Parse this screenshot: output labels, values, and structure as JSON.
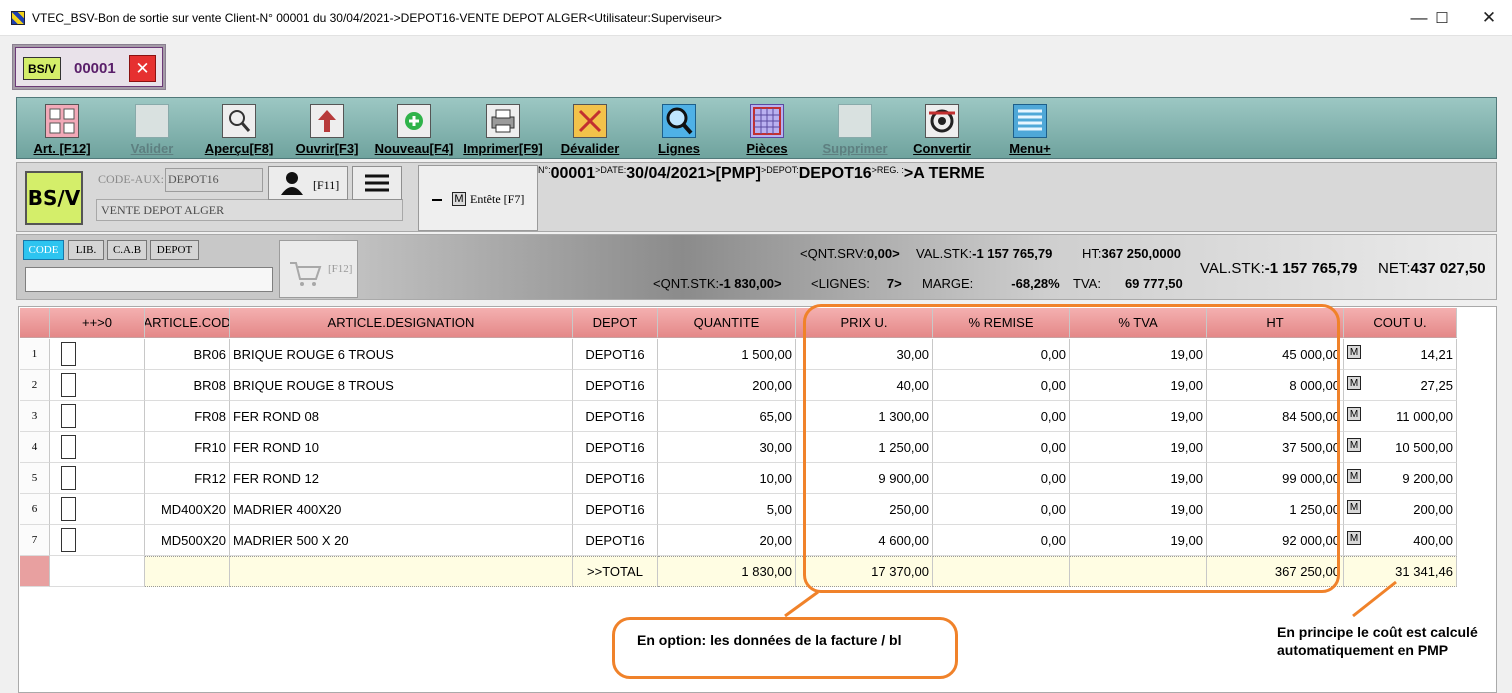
{
  "window": {
    "title": "VTEC_BSV-Bon de sortie sur vente Client-N° 00001 du 30/04/2021->DEPOT16-VENTE DEPOT ALGER<Utilisateur:Superviseur>",
    "minimize": "—",
    "maximize": "☐",
    "close": "✕"
  },
  "doc_tab": {
    "badge": "BS/V",
    "number": "00001",
    "close": "✕"
  },
  "toolbar": {
    "items": [
      {
        "label": "Art. [F12]",
        "icon": "article-grid-icon"
      },
      {
        "label": "Valider",
        "icon": "validate-icon",
        "disabled": true
      },
      {
        "label": "Aperçu[F8]",
        "icon": "preview-magnifier-icon"
      },
      {
        "label": "Ouvrir[F3]",
        "icon": "open-arrow-icon"
      },
      {
        "label": "Nouveau[F4]",
        "icon": "new-plus-icon"
      },
      {
        "label": "Imprimer[F9]",
        "icon": "printer-icon"
      },
      {
        "label": "Dévalider",
        "icon": "unvalidate-icon"
      },
      {
        "label": "Lignes",
        "icon": "lines-search-icon"
      },
      {
        "label": "Pièces",
        "icon": "pieces-calendar-icon"
      },
      {
        "label": "Supprimer",
        "icon": "delete-trash-icon",
        "disabled": true
      },
      {
        "label": "Convertir",
        "icon": "convert-cycle-icon"
      },
      {
        "label": "Menu+",
        "icon": "menu-list-icon"
      }
    ]
  },
  "header": {
    "badge": "BS/V",
    "code_aux_label": "CODE-AUX:",
    "code_aux_value": "DEPOT16",
    "client_name": "VENTE DEPOT ALGER",
    "person_key": "[F11]",
    "entete_m": "M",
    "entete_label": "Entête [F7]",
    "docline": {
      "no_label": "N°:",
      "no": "00001",
      "date_label": ">DATE:",
      "date": "30/04/2021",
      "pmp": ">[PMP]",
      "depot_label": ">DEPOT:",
      "depot": "DEPOT16",
      "reg_label": ">REG. :",
      "reg": ">A TERME"
    }
  },
  "search": {
    "segments": [
      "CODE",
      "LIB.",
      "C.A.B",
      "DEPOT"
    ],
    "cart_key": "[F12]"
  },
  "totals": {
    "qnt_srv_label": "<QNT.SRV:",
    "qnt_srv": "0,00>",
    "val_stk_label": "VAL.STK:",
    "val_stk": "-1 157 765,79",
    "ht_label": "HT:",
    "ht": "367 250,0000",
    "qnt_stk_label": "<QNT.STK:",
    "qnt_stk": "-1 830,00>",
    "lignes_label": "<LIGNES:",
    "lignes": "7>",
    "marge_label": "MARGE:",
    "marge": "-68,28%",
    "tva_label": "TVA:",
    "tva": "69 777,50",
    "val_stk2_label": "VAL.STK:",
    "val_stk2": "-1 157 765,79",
    "net_label": "NET:",
    "net": "437 027,50"
  },
  "grid": {
    "columns": [
      "++>0",
      "ARTICLE.COD",
      "ARTICLE.DESIGNATION",
      "DEPOT",
      "QUANTITE",
      "PRIX U.",
      "% REMISE",
      "% TVA",
      "HT",
      "COUT U."
    ],
    "rows": [
      {
        "n": "1",
        "code": "BR06",
        "des": "BRIQUE ROUGE 6 TROUS",
        "depot": "DEPOT16",
        "qte": "1 500,00",
        "prix": "30,00",
        "remise": "0,00",
        "tva": "19,00",
        "ht": "45 000,00",
        "m": "M",
        "cout": "14,21"
      },
      {
        "n": "2",
        "code": "BR08",
        "des": "BRIQUE ROUGE 8 TROUS",
        "depot": "DEPOT16",
        "qte": "200,00",
        "prix": "40,00",
        "remise": "0,00",
        "tva": "19,00",
        "ht": "8 000,00",
        "m": "M",
        "cout": "27,25"
      },
      {
        "n": "3",
        "code": "FR08",
        "des": "FER ROND 08",
        "depot": "DEPOT16",
        "qte": "65,00",
        "prix": "1 300,00",
        "remise": "0,00",
        "tva": "19,00",
        "ht": "84 500,00",
        "m": "M",
        "cout": "11 000,00"
      },
      {
        "n": "4",
        "code": "FR10",
        "des": "FER ROND 10",
        "depot": "DEPOT16",
        "qte": "30,00",
        "prix": "1 250,00",
        "remise": "0,00",
        "tva": "19,00",
        "ht": "37 500,00",
        "m": "M",
        "cout": "10 500,00"
      },
      {
        "n": "5",
        "code": "FR12",
        "des": "FER ROND 12",
        "depot": "DEPOT16",
        "qte": "10,00",
        "prix": "9 900,00",
        "remise": "0,00",
        "tva": "19,00",
        "ht": "99 000,00",
        "m": "M",
        "cout": "9 200,00"
      },
      {
        "n": "6",
        "code": "MD400X20",
        "des": "MADRIER 400X20",
        "depot": "DEPOT16",
        "qte": "5,00",
        "prix": "250,00",
        "remise": "0,00",
        "tva": "19,00",
        "ht": "1 250,00",
        "m": "M",
        "cout": "200,00"
      },
      {
        "n": "7",
        "code": "MD500X20",
        "des": "MADRIER 500 X 20",
        "depot": "DEPOT16",
        "qte": "20,00",
        "prix": "4 600,00",
        "remise": "0,00",
        "tva": "19,00",
        "ht": "92 000,00",
        "m": "M",
        "cout": "400,00"
      }
    ],
    "total": {
      "label": ">>TOTAL",
      "qte": "1 830,00",
      "prix": "17 370,00",
      "ht": "367 250,00",
      "cout": "31 341,46"
    }
  },
  "annotations": {
    "callout1": "En option: les données de la facture / bl",
    "callout2": "En principe le coût est calculé automatiquement en PMP",
    "accent": "#f0822a"
  }
}
